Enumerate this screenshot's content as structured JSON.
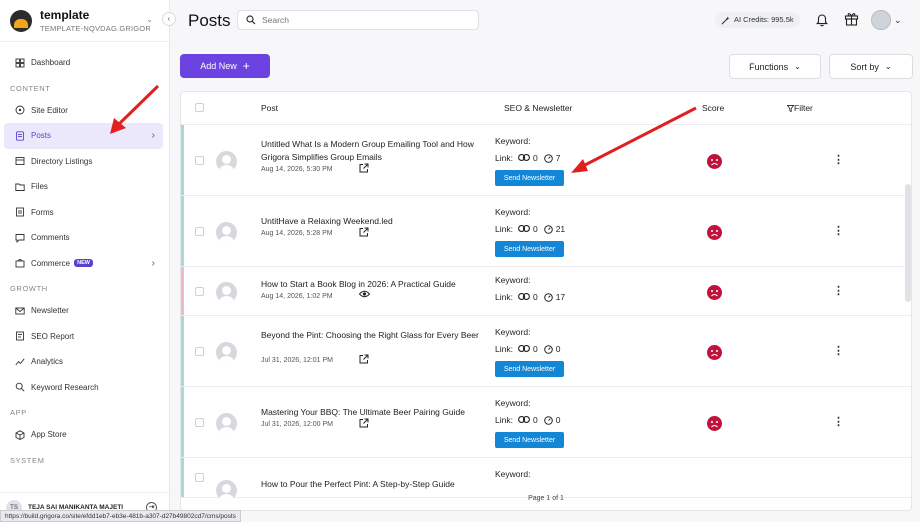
{
  "workspace": {
    "name": "template",
    "subtitle": "TEMPLATE-NQVDAG.GRIGOR..."
  },
  "sidebar": {
    "items_top": [
      {
        "label": "Dashboard",
        "icon": "dashboard-icon"
      }
    ],
    "sections": [
      {
        "label": "CONTENT",
        "items": [
          {
            "label": "Site Editor",
            "icon": "site-editor-icon"
          },
          {
            "label": "Posts",
            "icon": "posts-icon",
            "active": true,
            "arrow": "›"
          },
          {
            "label": "Directory Listings",
            "icon": "directory-icon"
          },
          {
            "label": "Files",
            "icon": "folder-icon"
          },
          {
            "label": "Forms",
            "icon": "forms-icon"
          },
          {
            "label": "Comments",
            "icon": "comments-icon"
          },
          {
            "label": "Commerce",
            "icon": "commerce-icon",
            "badge": "NEW",
            "arrow": "›"
          }
        ]
      },
      {
        "label": "GROWTH",
        "items": [
          {
            "label": "Newsletter",
            "icon": "mail-icon"
          },
          {
            "label": "SEO Report",
            "icon": "seo-report-icon"
          },
          {
            "label": "Analytics",
            "icon": "analytics-icon"
          },
          {
            "label": "Keyword Research",
            "icon": "search-icon"
          }
        ]
      },
      {
        "label": "APP",
        "items": [
          {
            "label": "App Store",
            "icon": "app-store-icon"
          }
        ]
      },
      {
        "label": "SYSTEM",
        "items": []
      }
    ],
    "user": {
      "initials": "TS",
      "name": "TEJA SAI MANIKANTA MAJETI"
    }
  },
  "header": {
    "title": "Posts",
    "search_placeholder": "Search",
    "credits": "AI Credits: 995.5k"
  },
  "actions": {
    "add_new": "Add New",
    "add_icon": "+",
    "functions": "Functions",
    "sort_by": "Sort by"
  },
  "table": {
    "columns": {
      "post": "Post",
      "seo": "SEO & Newsletter",
      "score": "Score",
      "filter": "Filter"
    },
    "keyword_label": "Keyword:",
    "link_label": "Link:",
    "send_label": "Send Newsletter",
    "rows": [
      {
        "title": "Untitled What Is a Modern Group Emailing Tool and How Grigora Simplifies Group Emails",
        "date": "Aug 14, 2026, 5:30 PM",
        "link_count": "0",
        "click_count": "7",
        "accent": "#a9d9d3",
        "view_icon": "external-link-icon",
        "has_send": true
      },
      {
        "title": "UntitHave a Relaxing Weekend.led",
        "date": "Aug 14, 2026, 5:28 PM",
        "link_count": "0",
        "click_count": "21",
        "accent": "#a9d9d3",
        "view_icon": "external-link-icon",
        "has_send": true
      },
      {
        "title": "How to Start a Book Blog in 2026: A Practical Guide",
        "date": "Aug 14, 2026, 1:02 PM",
        "link_count": "0",
        "click_count": "17",
        "accent": "#f4b7c4",
        "view_icon": "eye-icon",
        "has_send": false
      },
      {
        "title": "Beyond the Pint: Choosing the Right Glass for Every Beer",
        "date": "Jul 31, 2026, 12:01 PM",
        "link_count": "0",
        "click_count": "0",
        "accent": "#a9d9d3",
        "view_icon": "external-link-icon",
        "has_send": true
      },
      {
        "title": "Mastering Your BBQ: The Ultimate Beer Pairing Guide",
        "date": "Jul 31, 2026, 12:00 PM",
        "link_count": "0",
        "click_count": "0",
        "accent": "#a9d9d3",
        "view_icon": "external-link-icon",
        "has_send": true
      },
      {
        "title": "How to Pour the Perfect Pint: A Step-by-Step Guide",
        "date": "",
        "link_count": "",
        "click_count": "",
        "accent": "#a9d9d3",
        "view_icon": "",
        "has_send": false
      }
    ],
    "pagination": "Page 1 of 1"
  },
  "status_url": "https://build.grigora.co/site/efdd1eb7-eb3e-481b-a307-d27b49802cd7/cms/posts",
  "colors": {
    "accent": "#6c43e0",
    "send": "#1386d6",
    "score_bad": "#c0123a",
    "annotation": "#e02020"
  }
}
